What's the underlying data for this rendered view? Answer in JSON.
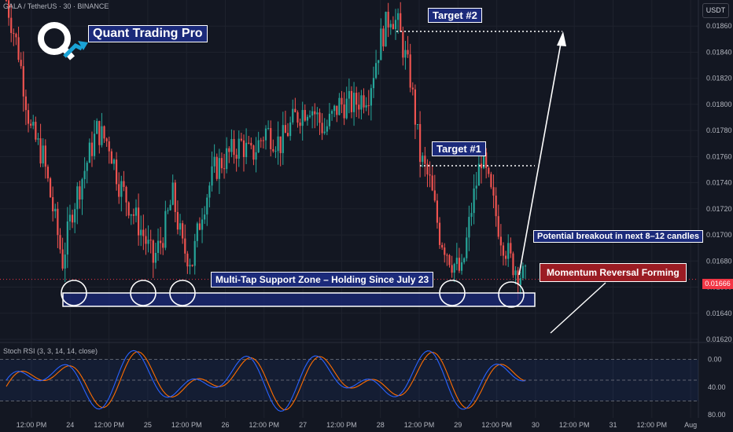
{
  "header": {
    "symbol": "GALA / TetherUS · 30 · BINANCE",
    "currency": "USDT"
  },
  "brand": {
    "name": "Quant Trading Pro"
  },
  "annotations": {
    "target2": "Target #2",
    "target1": "Target #1",
    "support_zone": "Multi-Tap Support Zone – Holding Since July 23",
    "breakout": "Potential breakout in next 8–12 candles",
    "momentum": "Momentum Reversal Forming"
  },
  "indicator": {
    "label": "Stoch RSI (3, 3, 14, 14, close)"
  },
  "price_label": "0.01666",
  "colors": {
    "bg": "#131722",
    "up": "#26a69a",
    "down": "#ef5350",
    "brand_box": "#1b2a7a",
    "momentum_box": "#9b1c23",
    "k_line": "#2962ff",
    "d_line": "#ff6d00"
  },
  "chart_data": {
    "type": "candlestick",
    "y_axis": {
      "ticks": [
        0.0162,
        0.0164,
        0.0166,
        0.0168,
        0.017,
        0.0172,
        0.0174,
        0.0176,
        0.0178,
        0.018,
        0.0182,
        0.0184,
        0.0186
      ],
      "tick_labels": [
        "0.01620",
        "0.01640",
        "0.01660",
        "0.01680",
        "0.01700",
        "0.01720",
        "0.01740",
        "0.01760",
        "0.01780",
        "0.01800",
        "0.01820",
        "0.01840",
        "0.01860"
      ],
      "range": [
        0.0162,
        0.0188
      ]
    },
    "x_axis": {
      "ticks": [
        "12:00 PM",
        "24",
        "12:00 PM",
        "25",
        "12:00 PM",
        "26",
        "12:00 PM",
        "27",
        "12:00 PM",
        "28",
        "12:00 PM",
        "29",
        "12:00 PM",
        "30",
        "12:00 PM",
        "31",
        "12:00 PM",
        "Aug"
      ]
    },
    "close_path": [
      [
        0,
        0.0188
      ],
      [
        5,
        0.0184
      ],
      [
        10,
        0.0178
      ],
      [
        15,
        0.0176
      ],
      [
        20,
        0.0171
      ],
      [
        23,
        0.0168
      ],
      [
        27,
        0.0172
      ],
      [
        32,
        0.0175
      ],
      [
        37,
        0.0178
      ],
      [
        42,
        0.0177
      ],
      [
        46,
        0.0174
      ],
      [
        51,
        0.0172
      ],
      [
        56,
        0.017
      ],
      [
        60,
        0.0168
      ],
      [
        64,
        0.017
      ],
      [
        68,
        0.0173
      ],
      [
        72,
        0.0169
      ],
      [
        76,
        0.0168
      ],
      [
        80,
        0.0172
      ],
      [
        85,
        0.0175
      ],
      [
        90,
        0.0176
      ],
      [
        96,
        0.0177
      ],
      [
        100,
        0.0176
      ],
      [
        106,
        0.0178
      ],
      [
        112,
        0.0177
      ],
      [
        118,
        0.0179
      ],
      [
        124,
        0.018
      ],
      [
        130,
        0.0178
      ],
      [
        136,
        0.018
      ],
      [
        142,
        0.018
      ],
      [
        148,
        0.0181
      ],
      [
        153,
        0.0185
      ],
      [
        157,
        0.0187
      ],
      [
        160,
        0.0186
      ],
      [
        165,
        0.0182
      ],
      [
        169,
        0.0176
      ],
      [
        173,
        0.0174
      ],
      [
        177,
        0.017
      ],
      [
        182,
        0.0168
      ],
      [
        186,
        0.0167
      ],
      [
        190,
        0.0172
      ],
      [
        194,
        0.0176
      ],
      [
        198,
        0.0173
      ],
      [
        202,
        0.017
      ],
      [
        206,
        0.0168
      ],
      [
        210,
        0.0167
      ],
      [
        212,
        0.01666
      ]
    ],
    "stoch_rsi": {
      "range": [
        0,
        100
      ],
      "tick_labels": [
        "0.00",
        "40.00",
        "80.00"
      ],
      "bands": [
        20,
        80
      ]
    }
  }
}
